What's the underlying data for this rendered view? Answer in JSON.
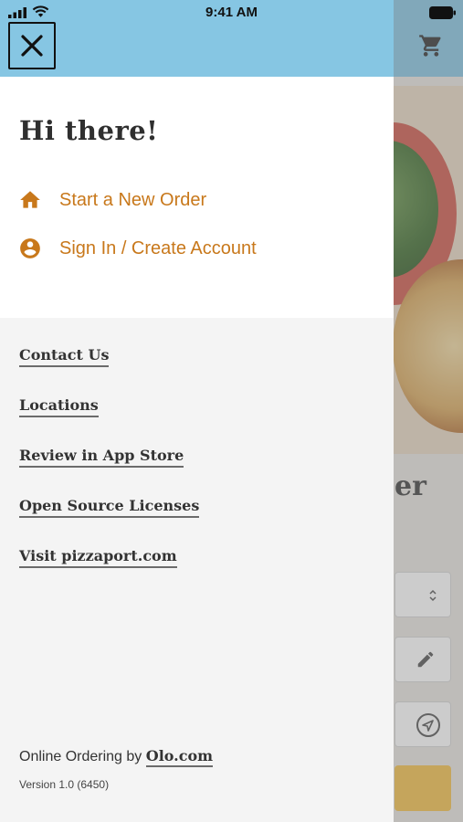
{
  "status_bar": {
    "time": "9:41 AM"
  },
  "background": {
    "partial_heading": "er"
  },
  "drawer": {
    "greeting": "Hi there!",
    "menu": [
      {
        "label": "Start a New Order",
        "icon": "home-icon"
      },
      {
        "label": "Sign In / Create Account",
        "icon": "account-circle-icon"
      }
    ],
    "links": [
      {
        "label": "Contact Us"
      },
      {
        "label": "Locations"
      },
      {
        "label": "Review in App Store"
      },
      {
        "label": "Open Source Licenses"
      },
      {
        "label": "Visit pizzaport.com"
      }
    ],
    "footer": {
      "prefix": "Online Ordering by",
      "olo_link": "Olo.com",
      "version": "Version 1.0 (6450)"
    }
  },
  "colors": {
    "header_blue": "#86c6e3",
    "accent_orange": "#c8781b",
    "drawer_bg": "#f4f4f4",
    "text_dark": "#333333"
  }
}
